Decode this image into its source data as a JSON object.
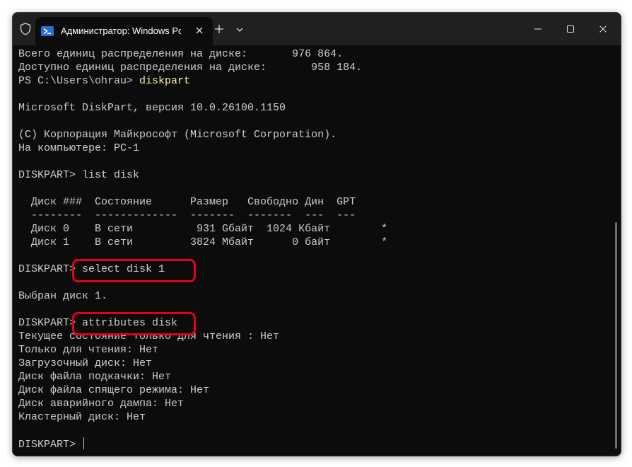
{
  "window": {
    "tab_title": "Администратор: Windows PowerShell"
  },
  "icons": {
    "shield": "shield-icon",
    "powershell": "powershell-icon",
    "tab_close": "close-icon",
    "new_tab": "plus-icon",
    "dropdown": "chevron-down-icon",
    "minimize": "minimize-icon",
    "maximize": "maximize-icon",
    "close": "close-icon"
  },
  "colors": {
    "console_bg": "#0c0c0c",
    "titlebar_bg": "#202020",
    "text": "#cccccc",
    "command_text": "#f9f1a5",
    "highlight": "#e3001b"
  },
  "console": {
    "lines": [
      {
        "text": "Всего единиц распределения на диске:       976 864."
      },
      {
        "text": "Доступно единиц распределения на диске:       958 184."
      },
      {
        "prompt": "PS C:\\Users\\ohrau> ",
        "cmd": "diskpart"
      },
      {
        "text": ""
      },
      {
        "text": "Microsoft DiskPart, версия 10.0.26100.1150"
      },
      {
        "text": ""
      },
      {
        "text": "(C) Корпорация Майкрософт (Microsoft Corporation)."
      },
      {
        "text": "На компьютере: PC-1"
      },
      {
        "text": ""
      },
      {
        "text": "DISKPART> list disk"
      },
      {
        "text": ""
      },
      {
        "text": "  Диск ###  Состояние      Размер   Свободно Дин  GPT"
      },
      {
        "text": "  --------  -------------  -------  -------  ---  ---"
      },
      {
        "text": "  Диск 0    В сети          931 Gбайт  1024 Кбайт        *"
      },
      {
        "text": "  Диск 1    В сети         3824 Мбайт      0 байт        *"
      },
      {
        "text": ""
      },
      {
        "text": "DISKPART> select disk 1"
      },
      {
        "text": ""
      },
      {
        "text": "Выбран диск 1."
      },
      {
        "text": ""
      },
      {
        "text": "DISKPART> attributes disk"
      },
      {
        "text": "Текущее состояние только для чтения : Нет"
      },
      {
        "text": "Только для чтения: Нет"
      },
      {
        "text": "Загрузочный диск: Нет"
      },
      {
        "text": "Диск файла подкачки: Нет"
      },
      {
        "text": "Диск файла спящего режима: Нет"
      },
      {
        "text": "Диск аварийного дампа: Нет"
      },
      {
        "text": "Кластерный диск: Нет"
      },
      {
        "text": ""
      },
      {
        "text": "DISKPART> ",
        "cursor": true
      }
    ]
  }
}
